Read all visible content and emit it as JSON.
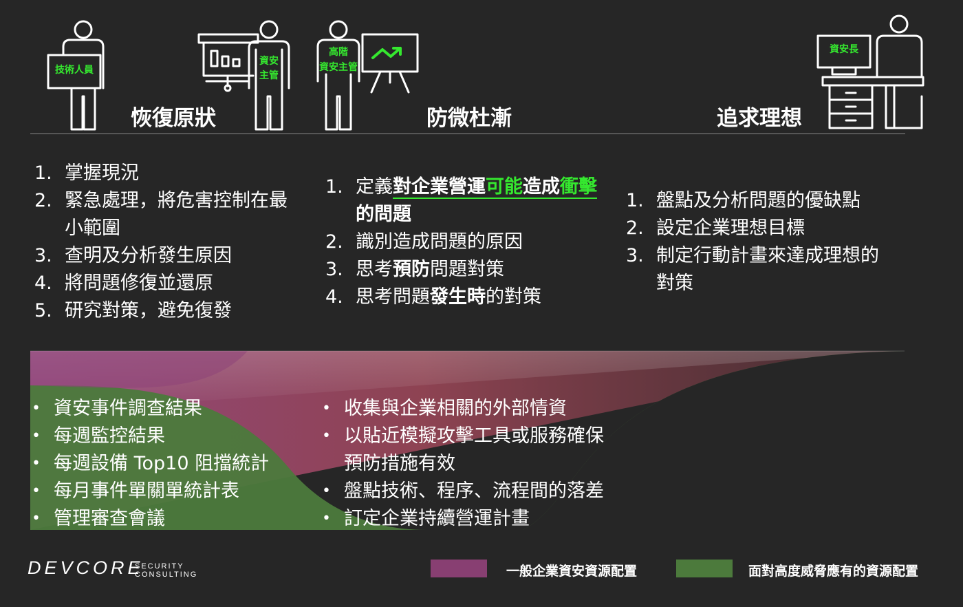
{
  "colors": {
    "background": "#262626",
    "accent_green": "#35e82f",
    "purple": "#883f72",
    "green": "#4c7a3c"
  },
  "figures": {
    "tech_staff": "技術人員",
    "sec_manager": [
      "資安",
      "主管"
    ],
    "senior_sec_manager": [
      "高階",
      "資安主管"
    ],
    "ciso": "資安長",
    "icons": [
      "person-icon",
      "whiteboard-icon",
      "bar-chart-icon",
      "trend-up-icon",
      "monitor-icon",
      "desk-icon"
    ]
  },
  "columns": [
    {
      "title": "恢復原狀",
      "steps": [
        {
          "num": "1.",
          "lines": [
            "掌握現況"
          ]
        },
        {
          "num": "2.",
          "lines": [
            "緊急處理，將危害控制在最",
            "小範圍"
          ]
        },
        {
          "num": "3.",
          "lines": [
            "查明及分析發生原因"
          ]
        },
        {
          "num": "4.",
          "lines": [
            "將問題修復並還原"
          ]
        },
        {
          "num": "5.",
          "lines": [
            "研究對策，避免復發"
          ]
        }
      ]
    },
    {
      "title": "防微杜漸",
      "steps": [
        {
          "num": "1.",
          "parts": [
            "定義",
            "對企業營運",
            "可能",
            "造成",
            "衝擊",
            "的問題"
          ]
        },
        {
          "num": "2.",
          "parts": [
            "識別造成問題的原因"
          ]
        },
        {
          "num": "3.",
          "parts": [
            "思考",
            "預防",
            "問題對策"
          ]
        },
        {
          "num": "4.",
          "parts": [
            "思考問題",
            "發生時",
            "的對策"
          ]
        }
      ]
    },
    {
      "title": "追求理想",
      "steps": [
        {
          "num": "1.",
          "lines": [
            "盤點及分析問題的優缺點"
          ]
        },
        {
          "num": "2.",
          "lines": [
            "設定企業理想目標"
          ]
        },
        {
          "num": "3.",
          "lines": [
            "制定行動計畫來達成理想的",
            "對策"
          ]
        }
      ]
    }
  ],
  "outputs_left": [
    "資安事件調查結果",
    "每週監控結果",
    "每週設備 Top10 阻擋統計",
    "每月事件單關單統計表",
    "管理審查會議"
  ],
  "outputs_mid": [
    "收集與企業相關的外部情資",
    "以貼近模擬攻擊工具或服務確保",
    "預防措施有效",
    "盤點技術、程序、流程間的落差",
    "訂定企業持續營運計畫"
  ],
  "logo": {
    "name": "DEVCORE",
    "sub1": "SECURITY",
    "sub2": "CONSULTING"
  },
  "legend": [
    {
      "label": "一般企業資安資源配置",
      "color": "#883f72"
    },
    {
      "label": "面對高度威脅應有的資源配置",
      "color": "#4c7a3c"
    }
  ]
}
